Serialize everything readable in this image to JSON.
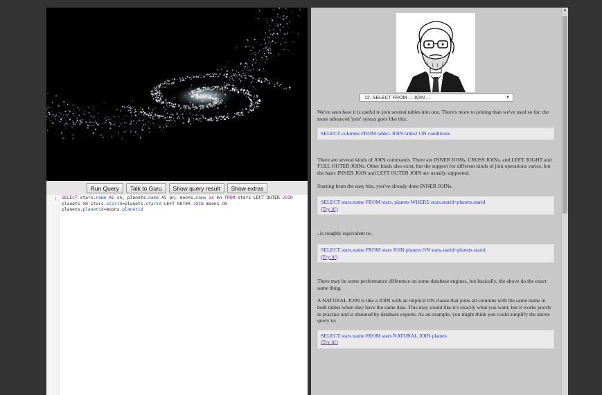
{
  "toolbar": {
    "run_query": "Run Query",
    "talk_to_guru": "Talk to Guru",
    "show_query_result": "Show query result",
    "show_extras": "Show extras"
  },
  "editor": {
    "line_number": "1",
    "tokens": [
      {
        "t": "SELECT ",
        "c": "kw"
      },
      {
        "t": "stars.",
        "c": "vr"
      },
      {
        "t": "name",
        "c": "pr"
      },
      {
        "t": " AS ",
        "c": "kw"
      },
      {
        "t": "sn, planets.",
        "c": "vr"
      },
      {
        "t": "name",
        "c": "pr"
      },
      {
        "t": " AS ",
        "c": "kw"
      },
      {
        "t": "pn, moons.",
        "c": "vr"
      },
      {
        "t": "name",
        "c": "pr"
      },
      {
        "t": " as ",
        "c": "kw"
      },
      {
        "t": "mn ",
        "c": "vr"
      },
      {
        "t": "FROM ",
        "c": "kw"
      },
      {
        "t": "stars ",
        "c": "vr"
      },
      {
        "t": "LEFT OUTER ",
        "c": "vr"
      },
      {
        "t": "JOIN ",
        "c": "kw"
      },
      {
        "t": "planets ",
        "c": "vr"
      },
      {
        "t": "ON ",
        "c": "kw"
      },
      {
        "t": "stars.",
        "c": "vr"
      },
      {
        "t": "starid",
        "c": "pr"
      },
      {
        "t": "=planets.",
        "c": "vr"
      },
      {
        "t": "starid",
        "c": "pr"
      },
      {
        "t": " LEFT OUTER ",
        "c": "vr"
      },
      {
        "t": "JOIN ",
        "c": "kw"
      },
      {
        "t": "moons ",
        "c": "vr"
      },
      {
        "t": "ON ",
        "c": "kw"
      },
      {
        "t": "planets.",
        "c": "vr"
      },
      {
        "t": "planetid",
        "c": "pr"
      },
      {
        "t": "=moons.",
        "c": "vr"
      },
      {
        "t": "planetid",
        "c": "pr"
      }
    ]
  },
  "guru": {
    "topic_selected": "12. SELECT FROM ... JOIN ...",
    "arrow": "▼"
  },
  "lesson": {
    "p1": "We've seen how it is useful to join several tables into one. There's more to joining than we've used so far; the more advanced 'join' syntax goes like this:",
    "code1": "SELECT columns FROM table1 JOIN table2 ON conditions",
    "p2": "There are several kinds of JOIN commands. There are INNER JOINs, CROSS JOINs, and LEFT, RIGHT and FULL OUTER JOINs. Other kinds also exist, but the support for different kinds of join operations varies, but the basic INNER JOIN and LEFT OUTER JOIN are usually supported.",
    "p3": "Starting from the easy bits, you've already done INNER JOINs.",
    "code2": "SELECT stars.name FROM stars, planets WHERE stars.starid=planets.starid",
    "try2": "(Try it!)",
    "p4": "..is roughly equivalent to..",
    "code3": "SELECT stars.name FROM stars JOIN planets ON stars.starid=planets.starid",
    "try3": "(Try it!)",
    "p5": "There may be some performance difference on some database engines, but basically, the above do the exact same thing.",
    "p6": "A NATURAL JOIN is like a JOIN with an implicit ON clause that joins all columns with the same name in both tables when they have the same data. This may sound like it's exactly what you want, but it works poorly in practice and is shunned by database experts. As an example, you might think you could simplify the above query to:",
    "code4": "SELECT stars.name FROM stars NATURAL JOIN planets",
    "try4": "(Try it!)"
  },
  "scrollbar": {
    "up_arrow": "▲"
  }
}
